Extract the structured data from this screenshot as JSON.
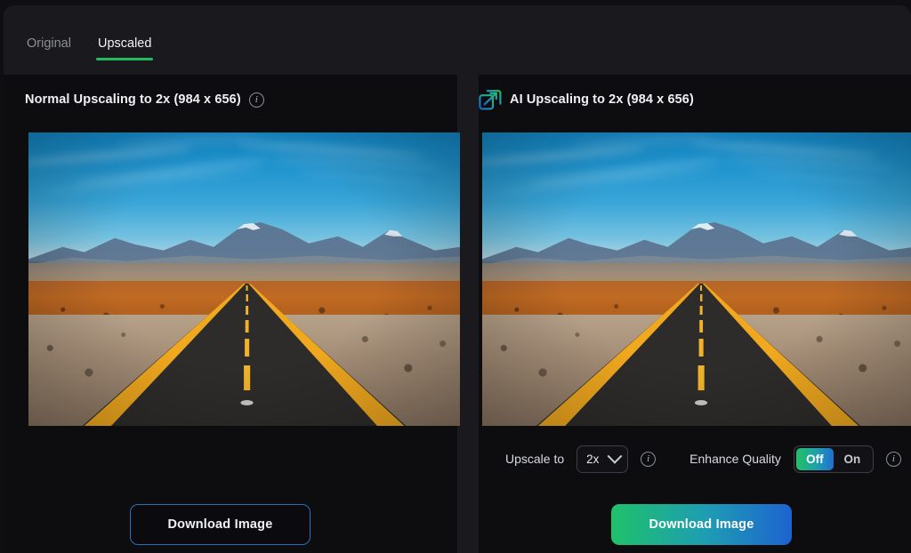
{
  "tabs": [
    {
      "label": "Original",
      "active": false
    },
    {
      "label": "Upscaled",
      "active": true
    }
  ],
  "accent": {
    "tab_underline": "#22bb62",
    "gradient_from": "#1fc16b",
    "gradient_mid": "#1e9db3",
    "gradient_to": "#1d63cf",
    "outline_button_border": "#2b6fb8"
  },
  "panels": {
    "left": {
      "title": "Normal Upscaling to 2x (984 x 656)",
      "info_icon": "info-icon",
      "download_label": "Download Image"
    },
    "right": {
      "title": "AI Upscaling to 2x (984 x 656)",
      "badge_icon": "ai-upscale-icon",
      "download_label": "Download Image",
      "controls": {
        "upscale_label": "Upscale to",
        "upscale_value": "2x",
        "upscale_options": [
          "2x"
        ],
        "upscale_info_icon": "info-icon",
        "enhance_label": "Enhance Quality",
        "enhance_options": [
          "Off",
          "On"
        ],
        "enhance_selected": "Off",
        "enhance_info_icon": "info-icon"
      }
    }
  },
  "image": {
    "alt": "Straight desert highway leading toward snow-capped volcanic mountains under a blue sky",
    "sky_color": "#1f93cd",
    "terrain_color": "#c06a22",
    "road_color": "#2e2c2b",
    "line_color": "#f0a81e"
  }
}
